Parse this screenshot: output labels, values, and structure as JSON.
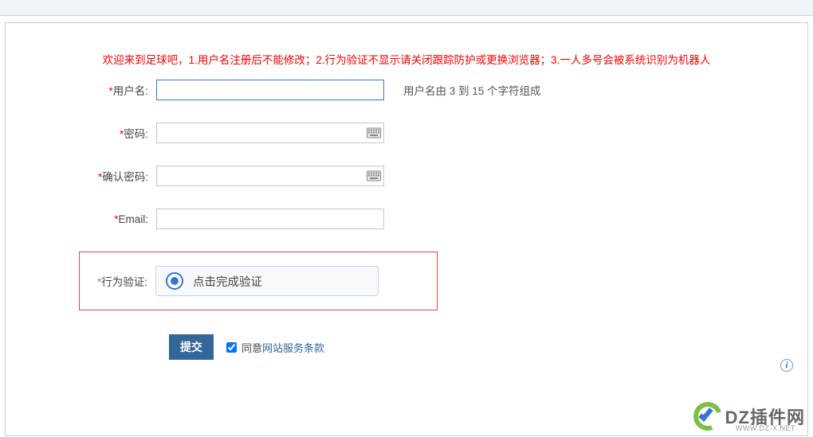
{
  "notice": "欢迎来到足球吧，1.用户名注册后不能修改；2.行为验证不显示请关闭跟踪防护或更换浏览器；3.一人多号会被系统识别为机器人",
  "fields": {
    "username": {
      "label": "用户名:",
      "value": "",
      "hint": "用户名由 3 到 15 个字符组成"
    },
    "password": {
      "label": "密码:",
      "value": ""
    },
    "confirm": {
      "label": "确认密码:",
      "value": ""
    },
    "email": {
      "label": "Email:",
      "value": ""
    },
    "verify": {
      "label": "行为验证:",
      "button": "点击完成验证"
    }
  },
  "submit": "提交",
  "agree": {
    "prefix": "同意",
    "link": "网站服务条款",
    "checked": true
  },
  "watermark": {
    "text": "DZ插件网",
    "sub": "WWW.DZ-X.NET"
  }
}
